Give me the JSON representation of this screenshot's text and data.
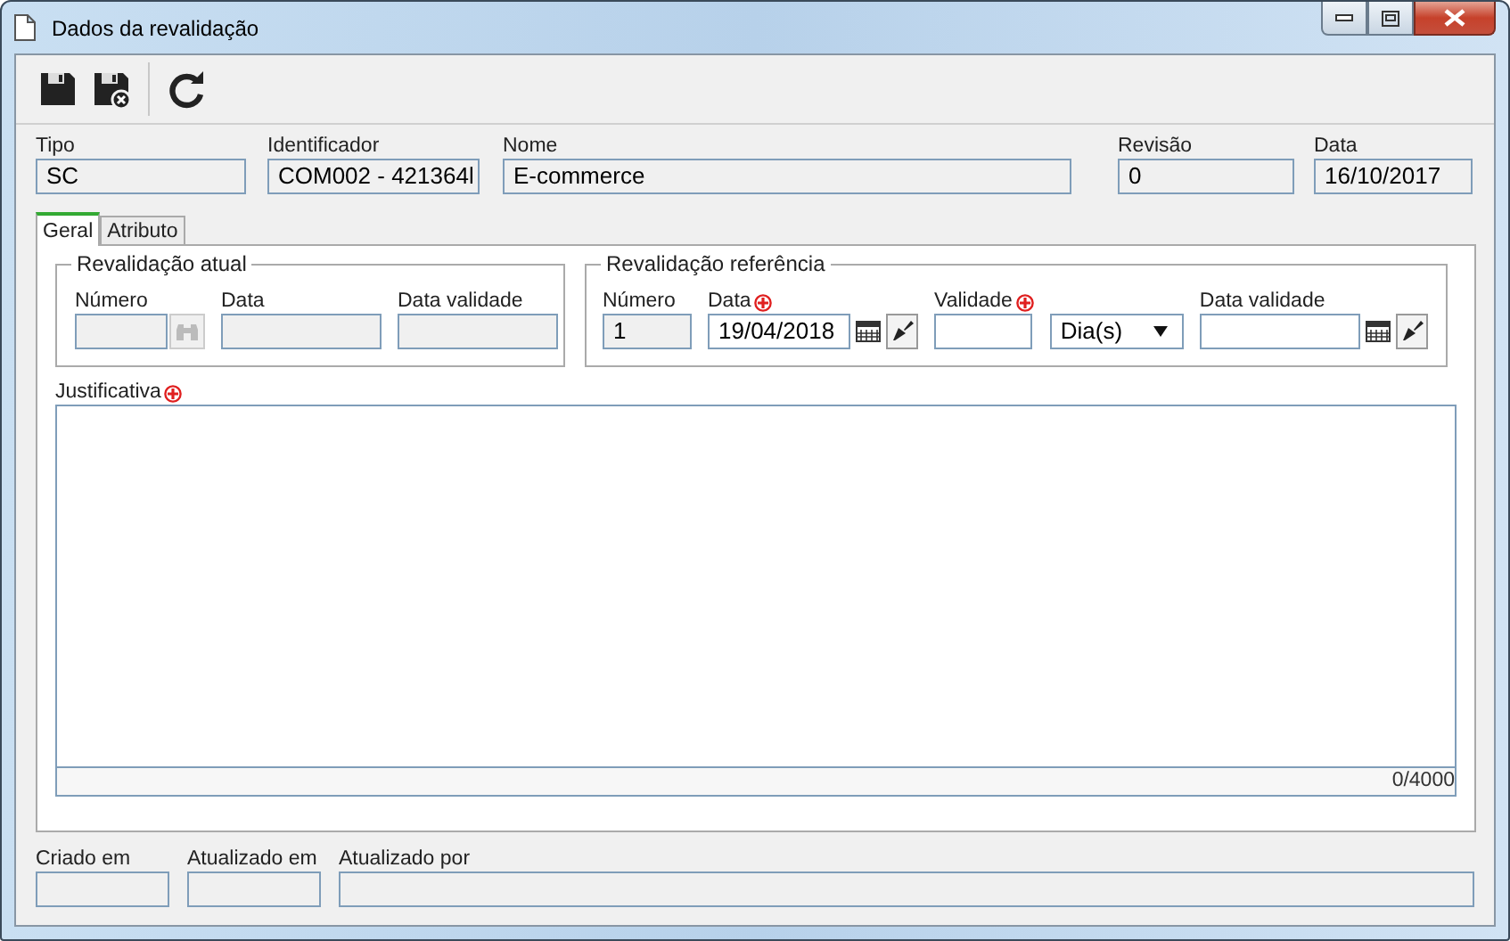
{
  "window": {
    "title": "Dados da revalidação"
  },
  "toolbar": [
    {
      "kind": "save"
    },
    {
      "kind": "save-close"
    },
    {
      "kind": "refresh"
    }
  ],
  "header_fields": [
    {
      "label": "Tipo",
      "value": "SC",
      "disabled": true
    },
    {
      "label": "Identificador",
      "value": "COM002 - 421364l",
      "disabled": true
    },
    {
      "label": "Nome",
      "value": "E-commerce",
      "disabled": true
    },
    {
      "label": "Revisão",
      "value": "0",
      "disabled": true
    },
    {
      "label": "Data",
      "value": "16/10/2017",
      "disabled": true
    }
  ],
  "tabs": [
    {
      "label": "Geral",
      "selected": true
    },
    {
      "label": "Atributo",
      "selected": false
    }
  ],
  "groups": [
    {
      "title": "Revalidação atual",
      "fields": [
        {
          "kind": "lookup",
          "label": "Número",
          "disabled": true,
          "required": false
        },
        {
          "kind": "text",
          "label": "Data",
          "disabled": true,
          "required": false
        },
        {
          "kind": "text",
          "label": "Data validade",
          "disabled": true,
          "required": false
        }
      ]
    },
    {
      "title": "Revalidação referência",
      "fields": [
        {
          "kind": "text",
          "label": "Número",
          "value": "1",
          "disabled": true,
          "required": false
        },
        {
          "kind": "date",
          "label": "Data",
          "value": "19/04/2018",
          "disabled": false,
          "required": true
        },
        {
          "kind": "text",
          "label": "Validade",
          "disabled": false,
          "required": true
        },
        {
          "kind": "select",
          "value": "Dia(s)",
          "disabled": false,
          "required": false
        },
        {
          "kind": "date",
          "label": "Data validade",
          "disabled": false,
          "required": false
        }
      ]
    }
  ],
  "justification": {
    "label": "Justificativa",
    "required": true,
    "counter": "0/4000"
  },
  "footer_fields": [
    {
      "label": "Criado em",
      "disabled": true
    },
    {
      "label": "Atualizado em",
      "disabled": true
    },
    {
      "label": "Atualizado por",
      "disabled": true
    }
  ]
}
